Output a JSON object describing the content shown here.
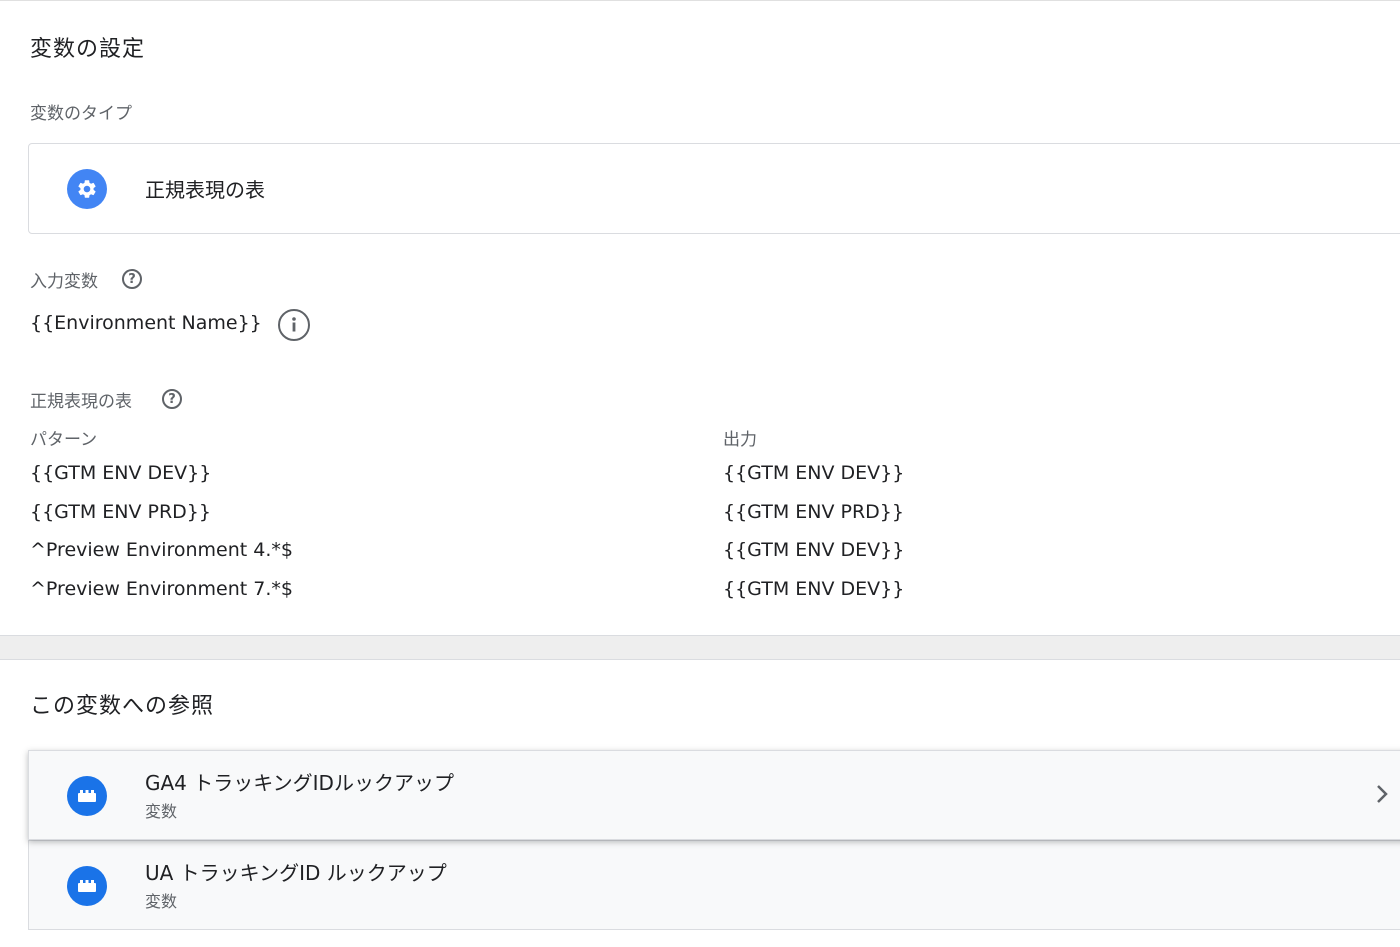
{
  "config": {
    "title": "変数の設定",
    "type_label": "変数のタイプ",
    "type_value": "正規表現の表",
    "input_label": "入力変数",
    "input_value": "{{Environment Name}}",
    "table_label": "正規表現の表",
    "table": {
      "headers": [
        "パターン",
        "出力"
      ],
      "rows": [
        [
          "{{GTM ENV DEV}}",
          "{{GTM ENV DEV}}"
        ],
        [
          "{{GTM ENV PRD}}",
          "{{GTM ENV PRD}}"
        ],
        [
          "^Preview Environment 4.*$",
          "{{GTM ENV DEV}}"
        ],
        [
          "^Preview Environment 7.*$",
          "{{GTM ENV DEV}}"
        ]
      ]
    }
  },
  "references": {
    "title": "この変数への参照",
    "items": [
      {
        "name": "GA4 トラッキングIDルックアップ",
        "type": "変数"
      },
      {
        "name": "UA トラッキングID ルックアップ",
        "type": "変数"
      }
    ]
  },
  "colors": {
    "accent": "#4285f4",
    "ref_icon": "#1a73e8",
    "muted_text": "#5f6368",
    "border": "#dadce0"
  },
  "icons": {
    "type_icon": "gear-icon",
    "help": "help-icon",
    "info": "info-icon",
    "ref_icon": "variable-block-icon",
    "chevron": "chevron-right-icon"
  }
}
